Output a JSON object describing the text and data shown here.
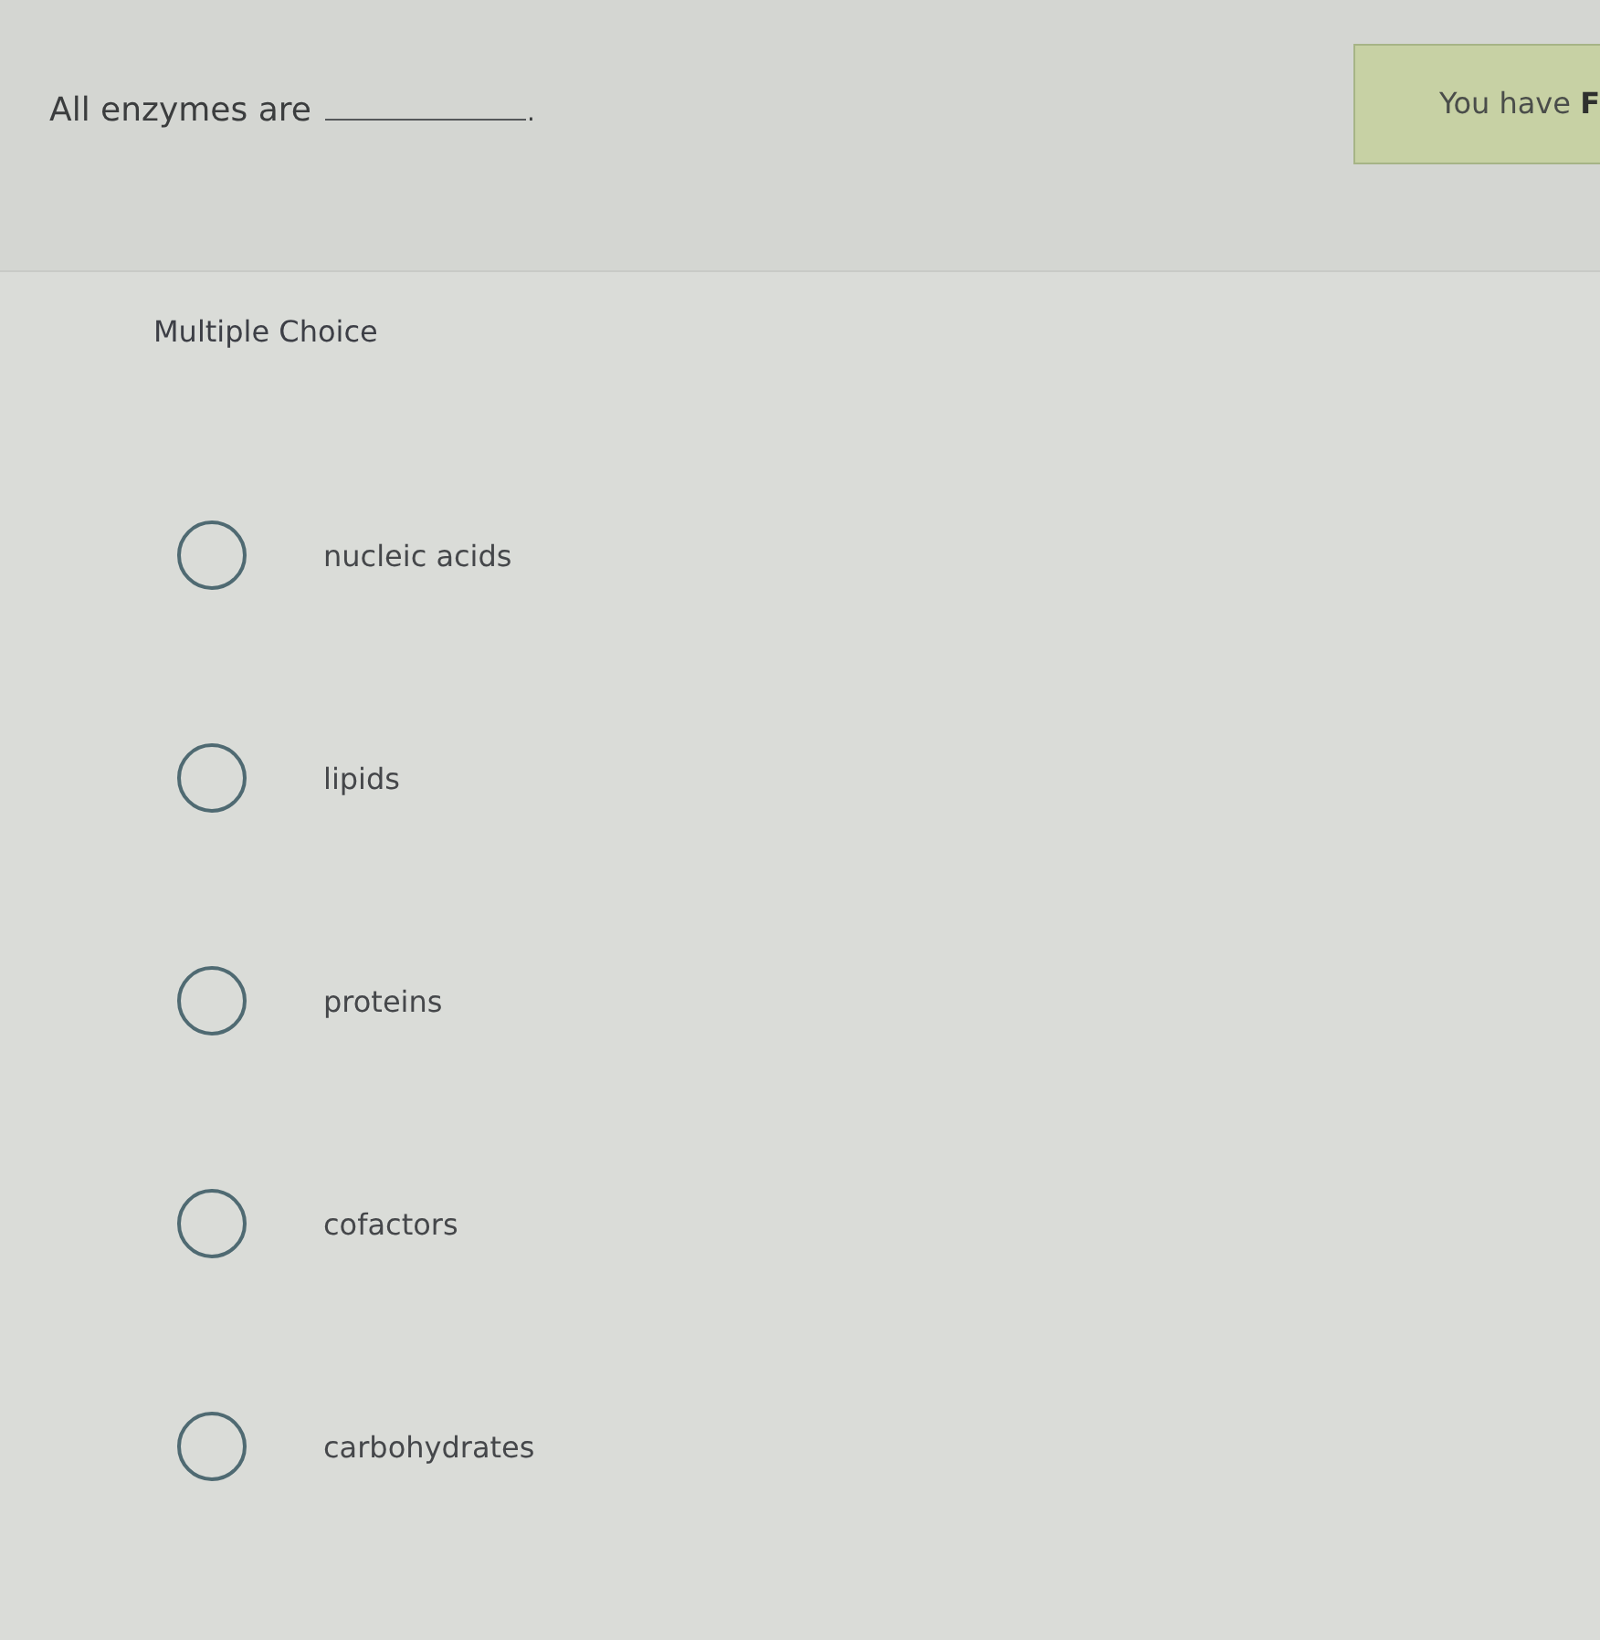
{
  "question": {
    "text_before": "All enzymes are",
    "text_after": "."
  },
  "banner": {
    "text": "You have **F**"
  },
  "panel": {
    "heading": "Multiple Choice",
    "options": [
      {
        "label": "nucleic acids",
        "selected": false
      },
      {
        "label": "lipids",
        "selected": false
      },
      {
        "label": "proteins",
        "selected": false
      },
      {
        "label": "cofactors",
        "selected": false
      },
      {
        "label": "carbohydrates",
        "selected": false
      }
    ]
  }
}
